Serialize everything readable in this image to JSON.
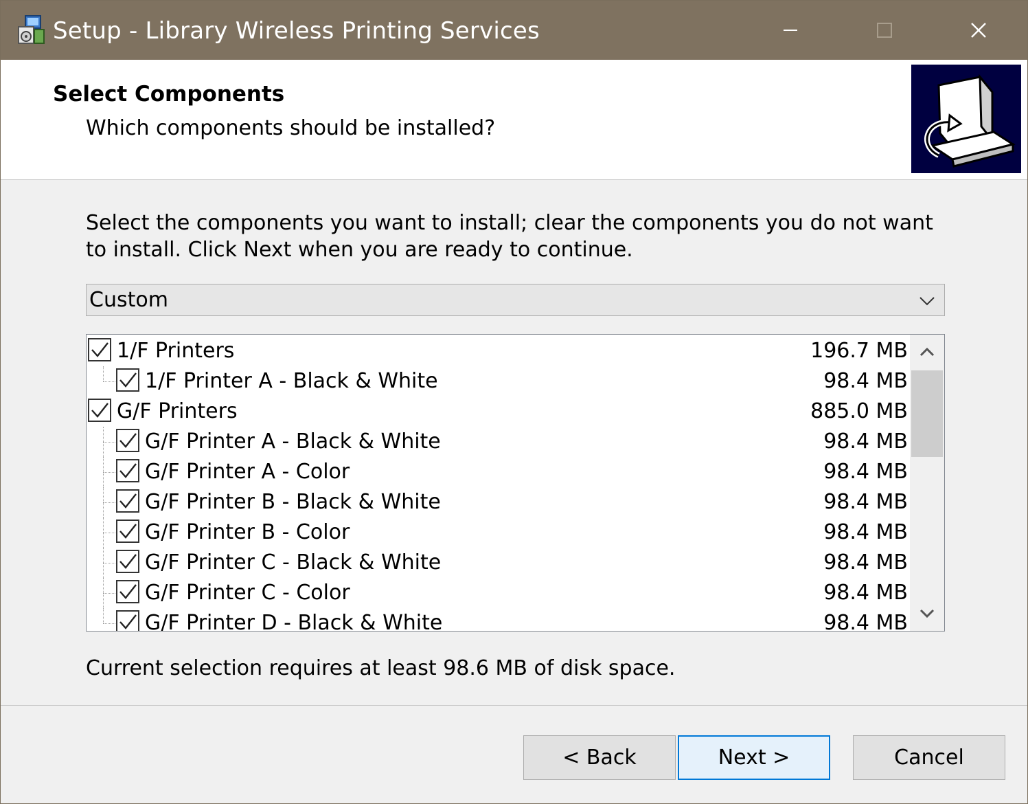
{
  "window": {
    "title": "Setup - Library Wireless Printing Services",
    "controls": {
      "minimize": "minimize",
      "maximize": "maximize",
      "close": "close"
    },
    "titlebar_color": "#7f7260"
  },
  "header": {
    "title": "Select Components",
    "subtitle": "Which components should be installed?"
  },
  "description": "Select the components you want to install; clear the components you do not want to install. Click Next when you are ready to continue.",
  "install_type": {
    "selected": "Custom"
  },
  "components": [
    {
      "label": "1/F Printers",
      "size": "196.7 MB",
      "checked": true,
      "level": 0
    },
    {
      "label": "1/F Printer A - Black & White",
      "size": "98.4 MB",
      "checked": true,
      "level": 1
    },
    {
      "label": "G/F Printers",
      "size": "885.0 MB",
      "checked": true,
      "level": 0
    },
    {
      "label": "G/F Printer A - Black & White",
      "size": "98.4 MB",
      "checked": true,
      "level": 1
    },
    {
      "label": "G/F Printer A - Color",
      "size": "98.4 MB",
      "checked": true,
      "level": 1
    },
    {
      "label": "G/F Printer B - Black & White",
      "size": "98.4 MB",
      "checked": true,
      "level": 1
    },
    {
      "label": "G/F Printer B - Color",
      "size": "98.4 MB",
      "checked": true,
      "level": 1
    },
    {
      "label": "G/F Printer C - Black & White",
      "size": "98.4 MB",
      "checked": true,
      "level": 1
    },
    {
      "label": "G/F Printer C - Color",
      "size": "98.4 MB",
      "checked": true,
      "level": 1
    },
    {
      "label": "G/F Printer D - Black & White",
      "size": "98.4 MB",
      "checked": true,
      "level": 1
    }
  ],
  "disk_space": "Current selection requires at least 98.6 MB of disk space.",
  "buttons": {
    "back": "< Back",
    "next": "Next >",
    "cancel": "Cancel"
  },
  "accent_color": "#0078d7"
}
